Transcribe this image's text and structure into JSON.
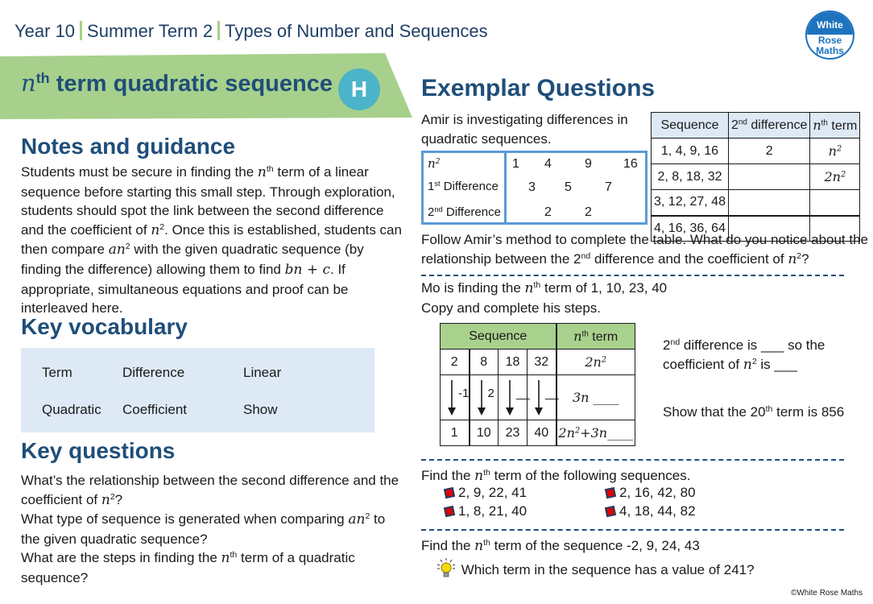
{
  "header": {
    "breadcrumb": [
      "Year 10",
      "Summer Term 2",
      "Types of Number and Sequences"
    ],
    "logo": {
      "line1": "White",
      "line2": "Rose",
      "line3": "Maths",
      "color": "#1e73be"
    }
  },
  "title": {
    "n": "n",
    "th": "th",
    "text": " term quadratic sequence",
    "tier_badge": "H",
    "banner_color": "#a7d08c",
    "badge_color": "#4bb4c8"
  },
  "notes": {
    "heading": "Notes and guidance",
    "segments": [
      "Students must be secure in finding the ",
      "n",
      "th",
      " term of a linear sequence before starting this small step. Through exploration, students should spot the link between the second difference and the coefficient of ",
      "n",
      "2",
      ". Once this is established, students can then compare ",
      "an",
      "2",
      " with the given quadratic sequence (by finding the difference) allowing them to find ",
      "bn + c",
      ". If appropriate, simultaneous equations and proof can be interleaved here."
    ]
  },
  "vocabulary": {
    "heading": "Key vocabulary",
    "words": [
      "Term",
      "Difference",
      "Linear",
      "Quadratic",
      "Coefficient",
      "Show"
    ]
  },
  "key_questions": {
    "heading": "Key questions",
    "q1": [
      "What’s the relationship between the second difference and the coefficient of ",
      "n",
      "2",
      "?"
    ],
    "q2": [
      "What type of sequence is generated when comparing ",
      "an",
      "2",
      " to the given quadratic sequence?"
    ],
    "q3": [
      "What are the steps in finding the ",
      "n",
      "th",
      " term of a quadratic sequence?"
    ]
  },
  "exemplar": {
    "heading": "Exemplar Questions",
    "amir_intro": "Amir is investigating differences in quadratic sequences.",
    "amir_table": {
      "row_labels": {
        "r1_math": "n",
        "r1_sup": "2",
        "r2_pre": "1",
        "r2_sup": "st",
        "r2_post": " Difference",
        "r3_pre": "2",
        "r3_sup": "nd",
        "r3_post": " Difference"
      },
      "squares": [
        "1",
        "4",
        "9",
        "16"
      ],
      "first_diff": [
        "3",
        "5",
        "7"
      ],
      "second_diff": [
        "2",
        "2"
      ]
    },
    "seq_table": {
      "headers": {
        "sequence": "Sequence",
        "diff_pre": "2",
        "diff_sup": "nd",
        "diff_post": " difference",
        "nth_math": "n",
        "nth_sup": "th",
        "nth_post": " term"
      },
      "rows": [
        {
          "sequence": "1, 4, 9, 16",
          "diff": "2",
          "nth_coef": "",
          "nth_var": "n",
          "nth_pow": "2"
        },
        {
          "sequence": "2, 8, 18, 32",
          "diff": "",
          "nth_coef": "2",
          "nth_var": "n",
          "nth_pow": "2"
        },
        {
          "sequence": "3, 12, 27, 48",
          "diff": "",
          "nth_coef": "",
          "nth_var": "",
          "nth_pow": ""
        },
        {
          "sequence": "4, 16, 36, 64",
          "diff": "",
          "nth_coef": "",
          "nth_var": "",
          "nth_pow": ""
        }
      ]
    },
    "follow": [
      "Follow Amir’s method to complete the table.  What do you notice about the relationship between the ",
      "2",
      "nd",
      " difference and the coefficient of ",
      "n",
      "2",
      "?"
    ],
    "mo": {
      "line1": [
        "Mo is finding the ",
        "n",
        "th",
        " term of 1, 10, 23, 40"
      ],
      "line2": "Copy and complete his steps.",
      "table": {
        "header_sequence": "Sequence",
        "header_nth_math": "n",
        "header_nth_sup": "th",
        "header_nth_post": " term",
        "row1": [
          "2",
          "8",
          "18",
          "32"
        ],
        "row1_nth": {
          "coef": "2",
          "var": "n",
          "pow": "2"
        },
        "arrow_labels": [
          "-1",
          "2",
          "__",
          "__"
        ],
        "row2_nth": {
          "coef": "3",
          "var": "n",
          "blank": " ____"
        },
        "row3": [
          "1",
          "10",
          "23",
          "40"
        ],
        "row3_nth": {
          "coef": "2",
          "var": "n",
          "pow": "2",
          "plus": "+3",
          "var2": "n",
          "blank": "____"
        }
      },
      "coef_text": [
        "2",
        "nd",
        " difference is ___ so the coefficient of ",
        "n",
        "2",
        " is ___"
      ],
      "show_text": [
        "Show that the 20",
        "th",
        " term is 856"
      ]
    },
    "find": {
      "intro": [
        "Find the ",
        "n",
        "th",
        " term of the following sequences."
      ],
      "sequences": [
        "2, 9, 22, 41",
        "2, 16, 42, 80",
        "1, 8, 21, 40",
        "4, 18, 44, 82"
      ]
    },
    "final": {
      "text": [
        "Find the ",
        "n",
        "th",
        " term of the sequence -2, 9, 24, 43"
      ],
      "hint": "Which term in the sequence has a value of 241?"
    }
  },
  "footer": {
    "copyright": "©White Rose Maths"
  }
}
